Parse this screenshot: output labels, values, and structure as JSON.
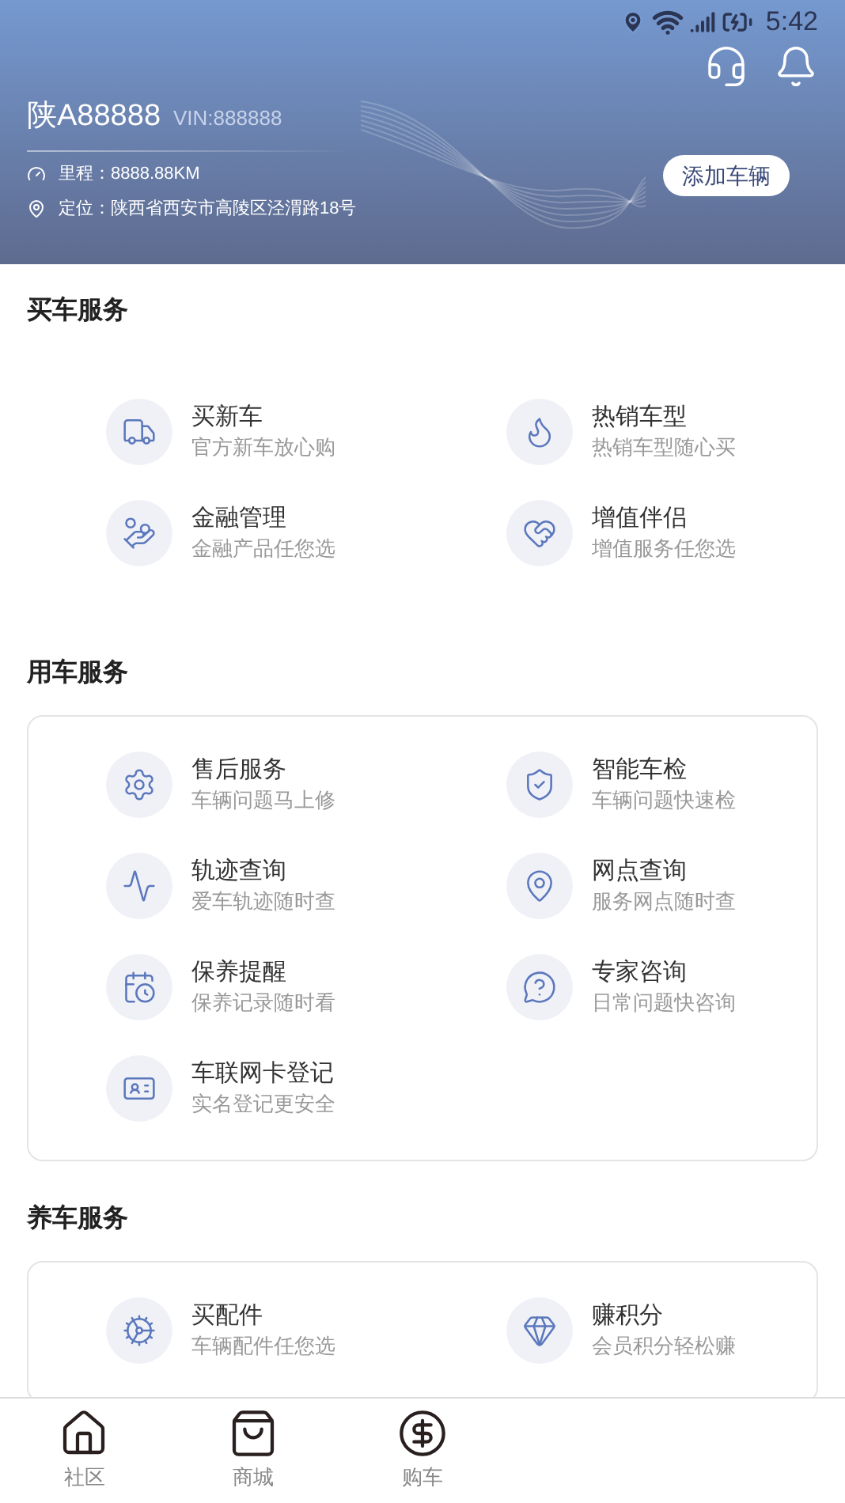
{
  "status_bar": {
    "time": "5:42"
  },
  "vehicle": {
    "plate": "陕A88888",
    "vin": "VIN:888888",
    "mileage": "里程：8888.88KM",
    "location": "定位：陕西省西安市高陵区泾渭路18号",
    "add_button": "添加车辆"
  },
  "sections": [
    {
      "title": "买车服务",
      "bordered": false,
      "items": [
        {
          "title": "买新车",
          "subtitle": "官方新车放心购"
        },
        {
          "title": "热销车型",
          "subtitle": "热销车型随心买"
        },
        {
          "title": "金融管理",
          "subtitle": "金融产品任您选"
        },
        {
          "title": "增值伴侣",
          "subtitle": "增值服务任您选"
        }
      ]
    },
    {
      "title": "用车服务",
      "bordered": true,
      "items": [
        {
          "title": "售后服务",
          "subtitle": "车辆问题马上修"
        },
        {
          "title": "智能车检",
          "subtitle": "车辆问题快速检"
        },
        {
          "title": "轨迹查询",
          "subtitle": "爱车轨迹随时查"
        },
        {
          "title": "网点查询",
          "subtitle": "服务网点随时查"
        },
        {
          "title": "保养提醒",
          "subtitle": "保养记录随时看"
        },
        {
          "title": "专家咨询",
          "subtitle": "日常问题快咨询"
        },
        {
          "title": "车联网卡登记",
          "subtitle": "实名登记更安全"
        }
      ]
    },
    {
      "title": "养车服务",
      "bordered": true,
      "items": [
        {
          "title": "买配件",
          "subtitle": "车辆配件任您选"
        },
        {
          "title": "赚积分",
          "subtitle": "会员积分轻松赚"
        }
      ]
    }
  ],
  "bottom_nav": [
    {
      "label": "社区",
      "selected": false
    },
    {
      "label": "商城",
      "selected": false
    },
    {
      "label": "购车",
      "selected": false
    }
  ]
}
